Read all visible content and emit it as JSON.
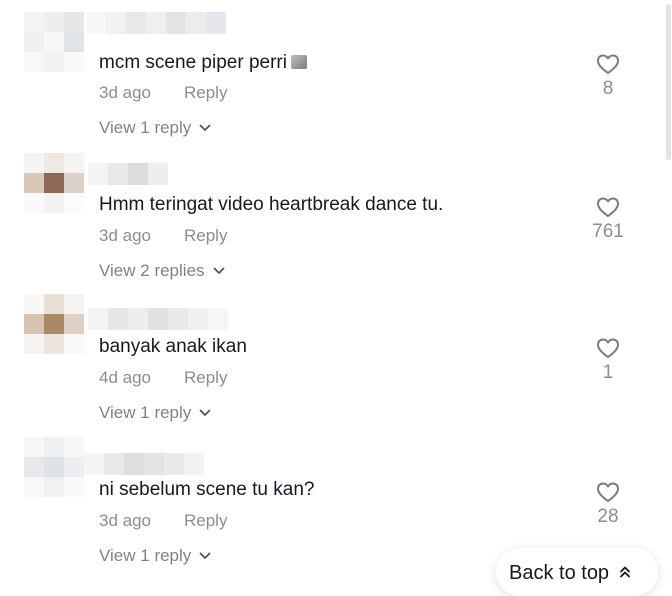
{
  "comments": [
    {
      "text": "mcm scene piper perri",
      "time": "3d ago",
      "reply_label": "Reply",
      "view_replies": "View 1 reply",
      "likes": "8",
      "has_emoji": true
    },
    {
      "text": "Hmm teringat video heartbreak dance tu.",
      "time": "3d ago",
      "reply_label": "Reply",
      "view_replies": "View 2 replies",
      "likes": "761"
    },
    {
      "text": "banyak anak ikan",
      "time": "4d ago",
      "reply_label": "Reply",
      "view_replies": "View 1 reply",
      "likes": "1"
    },
    {
      "text": "ni sebelum scene tu kan?",
      "time": "3d ago",
      "reply_label": "Reply",
      "view_replies": "View 1 reply",
      "likes": "28"
    }
  ],
  "back_to_top": "Back to top",
  "icons": {
    "like": "heart-outline-icon",
    "expand": "chevron-down-icon",
    "back_to_top": "double-chevron-up-icon",
    "emoji": "emoji-icon"
  },
  "colors": {
    "text": "#161823",
    "muted": "rgba(22,24,35,0.5)"
  }
}
